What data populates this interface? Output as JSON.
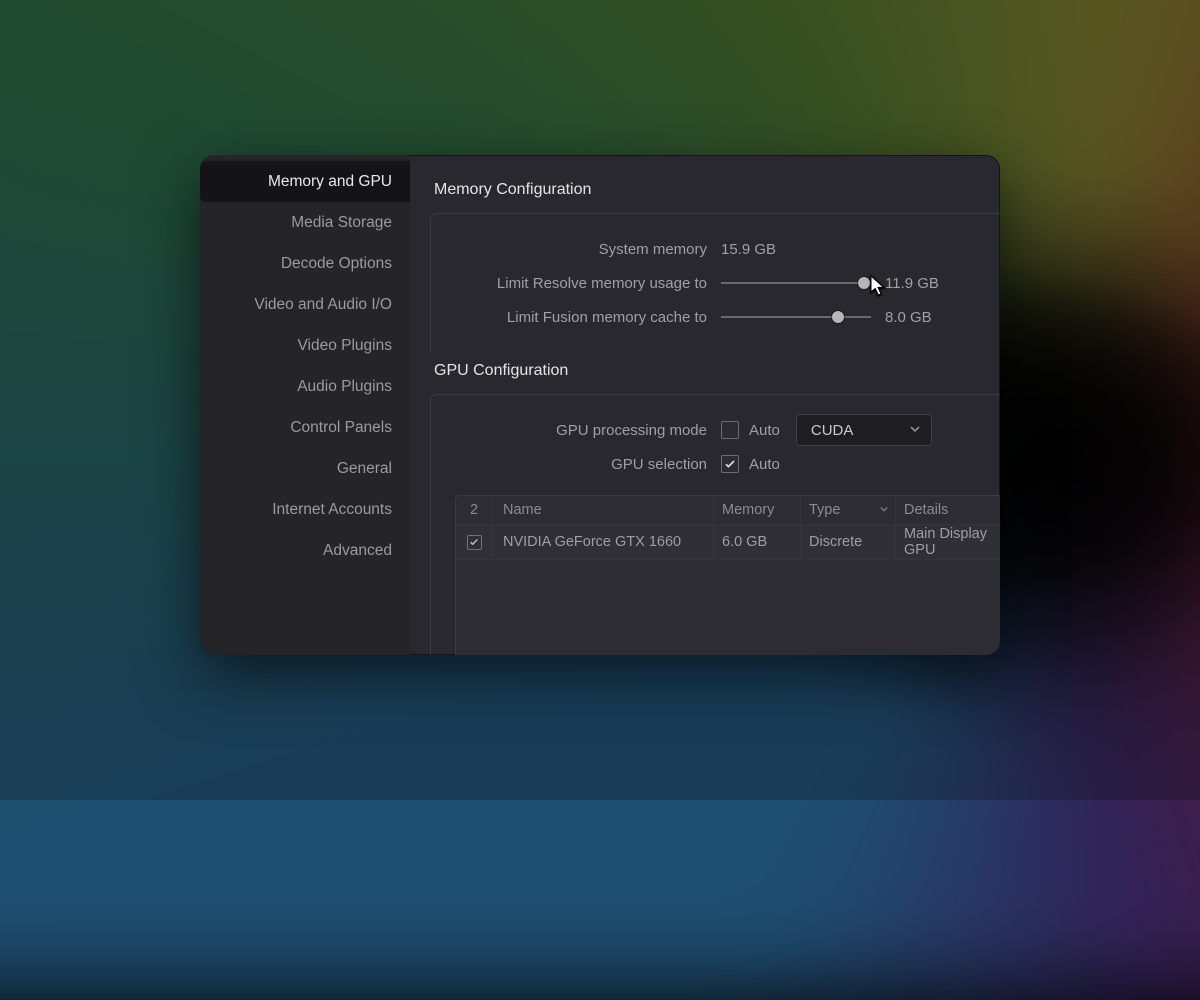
{
  "sidebar": [
    {
      "label": "Memory and GPU",
      "active": true
    },
    {
      "label": "Media Storage",
      "active": false
    },
    {
      "label": "Decode Options",
      "active": false
    },
    {
      "label": "Video and Audio I/O",
      "active": false
    },
    {
      "label": "Video Plugins",
      "active": false
    },
    {
      "label": "Audio Plugins",
      "active": false
    },
    {
      "label": "Control Panels",
      "active": false
    },
    {
      "label": "General",
      "active": false
    },
    {
      "label": "Internet Accounts",
      "active": false
    },
    {
      "label": "Advanced",
      "active": false
    }
  ],
  "memory": {
    "section_title": "Memory Configuration",
    "system_label": "System memory",
    "system_value": "15.9 GB",
    "resolve_label": "Limit Resolve memory usage to",
    "resolve_value": "11.9 GB",
    "resolve_pct": 95,
    "fusion_label": "Limit Fusion memory cache to",
    "fusion_value": "8.0 GB",
    "fusion_pct": 78
  },
  "gpu": {
    "section_title": "GPU Configuration",
    "mode_label": "GPU processing mode",
    "mode_auto_checked": false,
    "mode_auto_label": "Auto",
    "mode_select": "CUDA",
    "selection_label": "GPU selection",
    "selection_auto_checked": true,
    "selection_auto_label": "Auto",
    "table": {
      "count": "2",
      "headers": {
        "name": "Name",
        "memory": "Memory",
        "type": "Type",
        "details": "Details"
      },
      "rows": [
        {
          "checked": true,
          "name": "NVIDIA GeForce GTX 1660",
          "memory": "6.0 GB",
          "type": "Discrete",
          "details": "Main Display GPU"
        }
      ]
    }
  }
}
